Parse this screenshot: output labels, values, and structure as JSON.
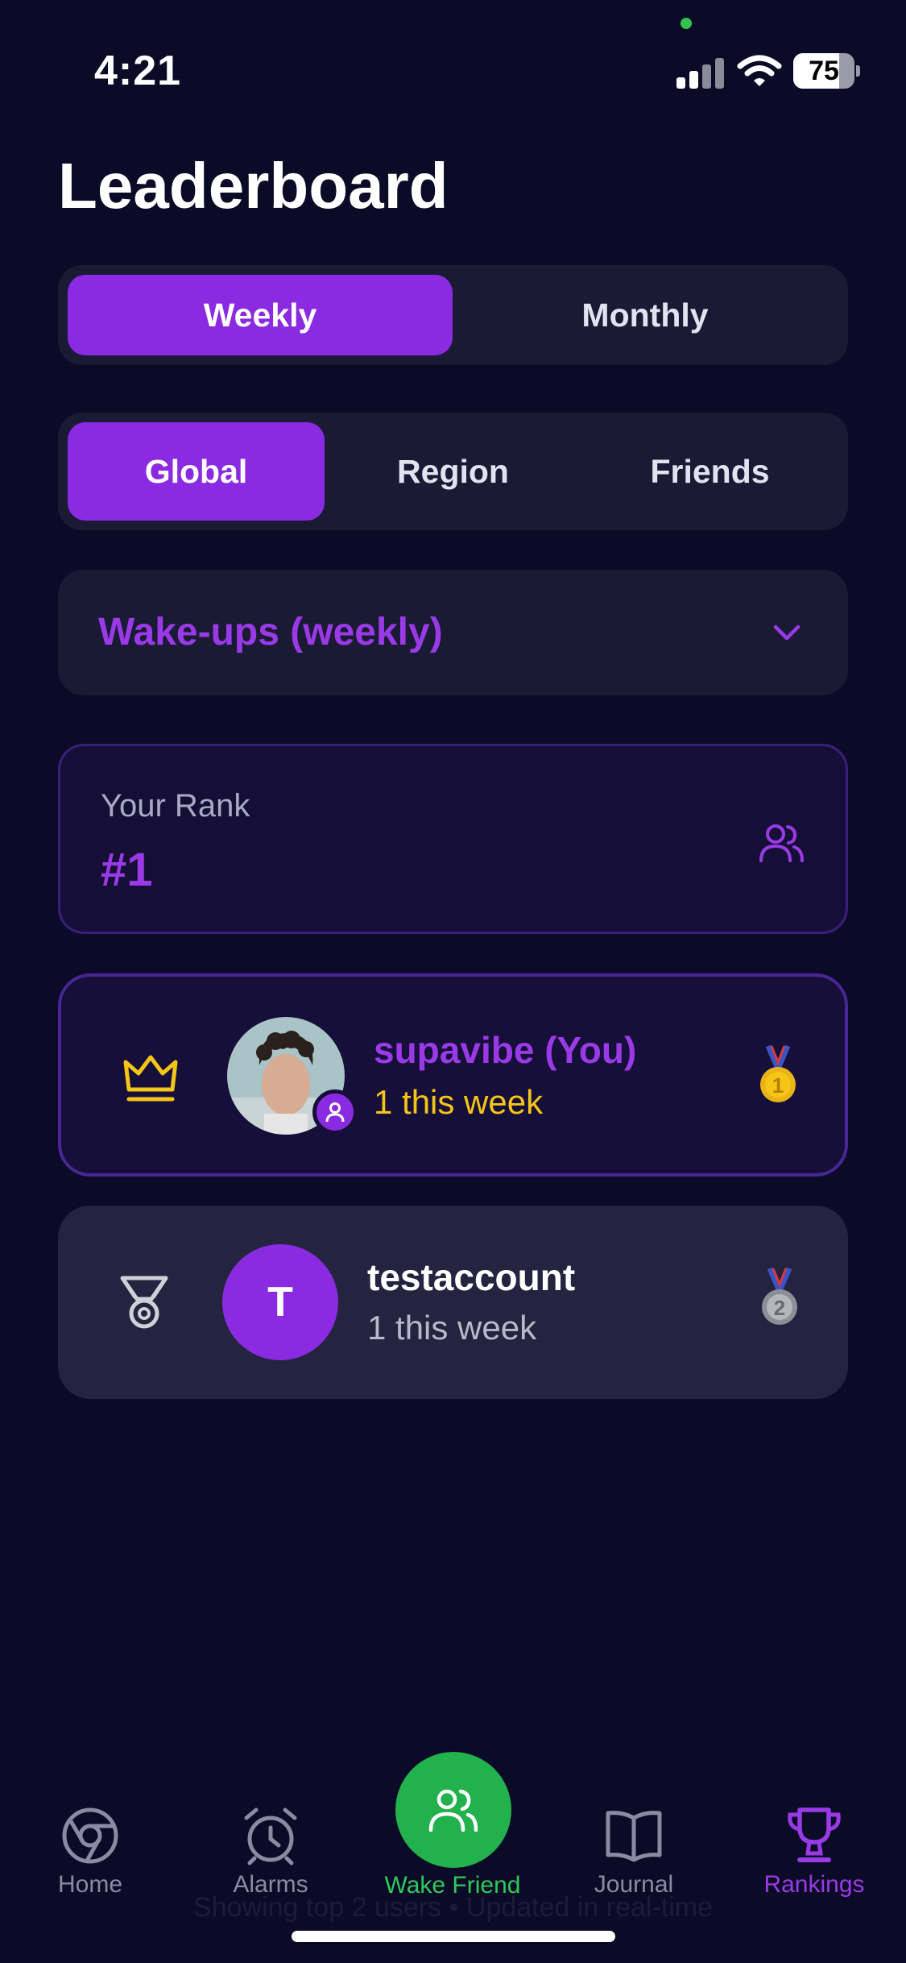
{
  "status_bar": {
    "time": "4:21",
    "battery": "75",
    "battery_level": 0.75
  },
  "header": {
    "title": "Leaderboard"
  },
  "period_tabs": [
    {
      "label": "Weekly",
      "active": true
    },
    {
      "label": "Monthly",
      "active": false
    }
  ],
  "scope_tabs": [
    {
      "label": "Global",
      "active": true
    },
    {
      "label": "Region",
      "active": false
    },
    {
      "label": "Friends",
      "active": false
    }
  ],
  "metric_dropdown": {
    "selected": "Wake-ups (weekly)"
  },
  "your_rank": {
    "label": "Your Rank",
    "value": "#1"
  },
  "entries": [
    {
      "name": "supavibe (You)",
      "subtitle": "1 this week",
      "rank": "1",
      "avatar": "photo",
      "highlight": true
    },
    {
      "name": "testaccount",
      "subtitle": "1 this week",
      "rank": "2",
      "avatar_letter": "T",
      "highlight": false
    }
  ],
  "footer_note": "Showing top 2 users • Updated in real-time",
  "bottom_nav": [
    {
      "label": "Home",
      "icon": "chrome-icon"
    },
    {
      "label": "Alarms",
      "icon": "alarm-clock-icon"
    },
    {
      "label": "Wake Friend",
      "icon": "users-icon"
    },
    {
      "label": "Journal",
      "icon": "book-open-icon"
    },
    {
      "label": "Rankings",
      "icon": "trophy-icon",
      "active": true
    }
  ],
  "colors": {
    "background": "#0b0b27",
    "accent_purple": "#8a2be2",
    "gold": "#f5c518",
    "green": "#22b14c"
  }
}
